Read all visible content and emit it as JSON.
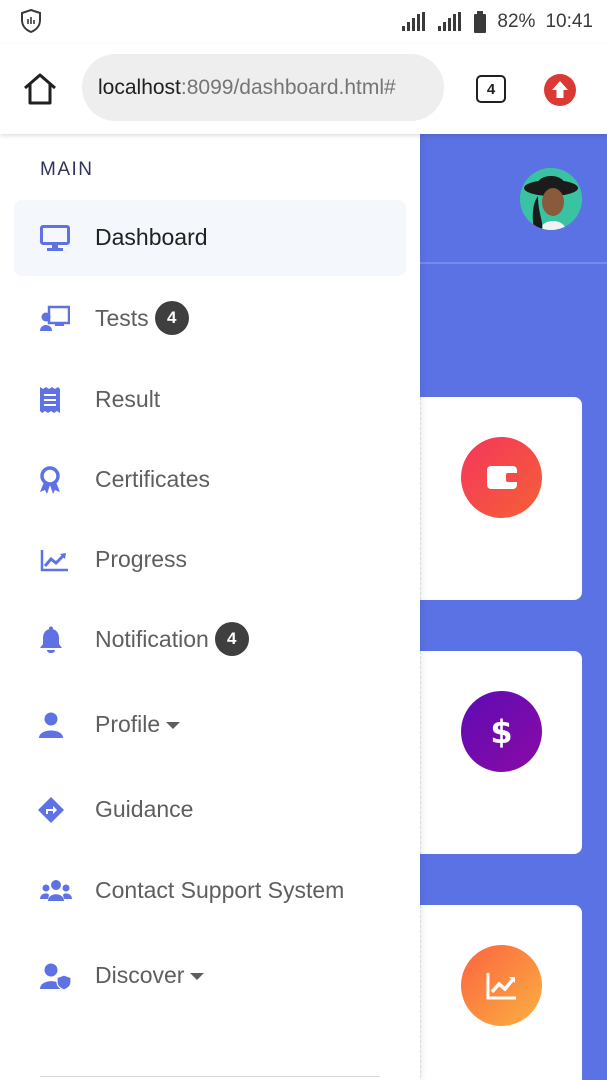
{
  "status_bar": {
    "battery": "82%",
    "time": "10:41"
  },
  "browser": {
    "url_host": "localhost",
    "url_rest": ":8099/dashboard.html#",
    "tab_count": "4"
  },
  "sidebar": {
    "heading": "MAIN",
    "items": [
      {
        "label": "Dashboard",
        "icon": "desktop-icon",
        "active": true
      },
      {
        "label": "Tests",
        "icon": "chalkboard-teacher-icon",
        "badge": "4"
      },
      {
        "label": "Result",
        "icon": "receipt-icon"
      },
      {
        "label": "Certificates",
        "icon": "award-icon"
      },
      {
        "label": "Progress",
        "icon": "chart-line-icon"
      },
      {
        "label": "Notification",
        "icon": "bell-icon",
        "badge": "4"
      },
      {
        "label": "Profile",
        "icon": "user-icon",
        "dropdown": true
      },
      {
        "label": "Guidance",
        "icon": "directions-icon"
      },
      {
        "label": "Contact Support System",
        "icon": "users-icon"
      },
      {
        "label": "Discover",
        "icon": "user-shield-icon",
        "dropdown": true
      }
    ]
  },
  "background_page": {
    "accent": "#5b72e4",
    "cards": [
      {
        "icon": "wallet-icon",
        "colors": [
          "#f5365c",
          "#f56036"
        ]
      },
      {
        "icon": "dollar-icon",
        "colors": [
          "#5e0bb4",
          "#8a0ba6"
        ]
      },
      {
        "icon": "chart-bar-icon",
        "colors": [
          "#fb6340",
          "#fbb140"
        ]
      }
    ]
  }
}
